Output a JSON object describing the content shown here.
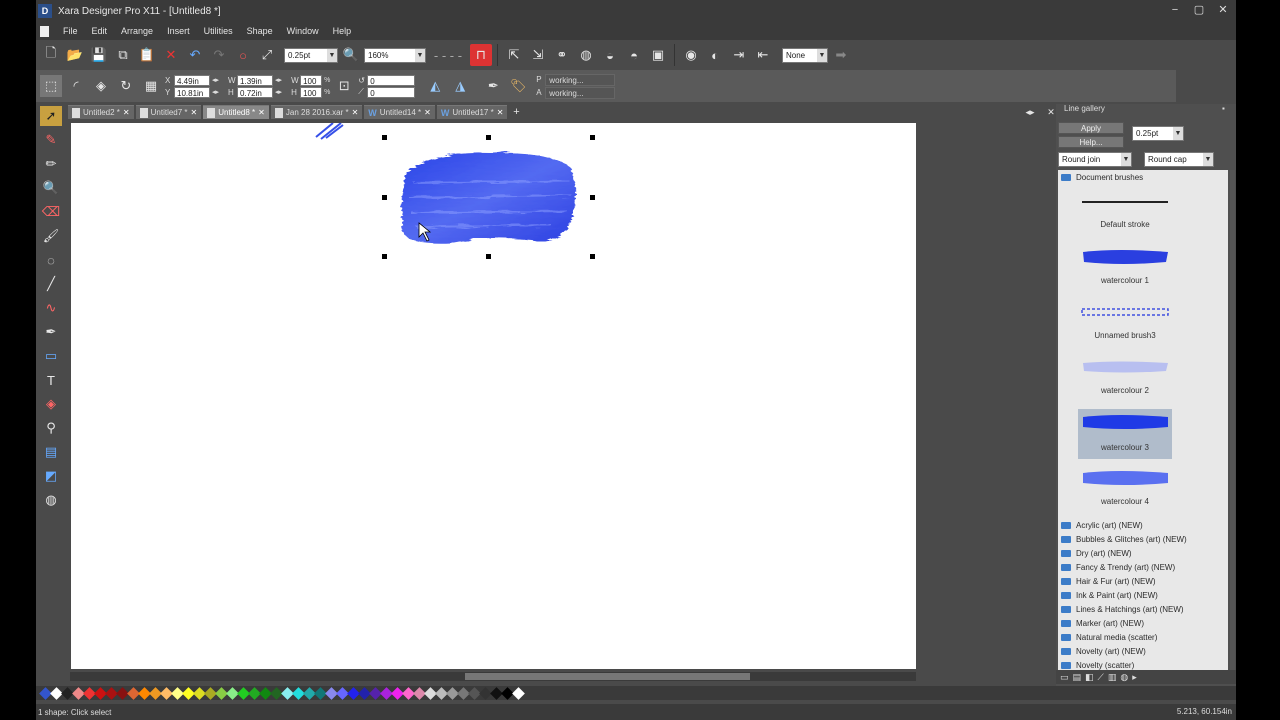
{
  "window": {
    "title": "Xara Designer Pro X11 - [Untitled8 *]",
    "logo": "D"
  },
  "menu": [
    "File",
    "Edit",
    "Arrange",
    "Insert",
    "Utilities",
    "Shape",
    "Window",
    "Help"
  ],
  "toolbar": {
    "line_width": "0.25pt",
    "zoom": "160%",
    "fill": "None"
  },
  "infobar": {
    "x": "4.49in",
    "y": "10.81in",
    "w": "1.39in",
    "h": "0.72in",
    "w_pct": "100",
    "h_pct": "100",
    "angle": "0",
    "skew": "0",
    "p_label": "P",
    "p_value": "working...",
    "a_label": "A",
    "a_value": "working..."
  },
  "tabs": [
    {
      "label": "Untitled2 *",
      "type": "doc"
    },
    {
      "label": "Untitled7 *",
      "type": "doc"
    },
    {
      "label": "Untitled8 *",
      "type": "doc",
      "active": true
    },
    {
      "label": "Jan 28 2016.xar *",
      "type": "doc"
    },
    {
      "label": "Untitled14 *",
      "type": "web"
    },
    {
      "label": "Untitled17 *",
      "type": "web"
    }
  ],
  "gallery": {
    "title": "Line gallery",
    "apply": "Apply",
    "help": "Help...",
    "width_value": "0.25pt",
    "join": "Round join",
    "cap": "Round cap",
    "doc_folder": "Document brushes",
    "brushes": [
      "Default stroke",
      "watercolour 1",
      "Unnamed brush3",
      "watercolour 2",
      "watercolour 3",
      "watercolour 4"
    ],
    "folders": [
      "Acrylic (art) (NEW)",
      "Bubbles & Glitches (art) (NEW)",
      "Dry (art) (NEW)",
      "Fancy & Trendy (art) (NEW)",
      "Hair & Fur (art) (NEW)",
      "Ink & Paint (art) (NEW)",
      "Lines & Hatchings (art) (NEW)",
      "Marker (art) (NEW)",
      "Natural media (scatter)",
      "Novelty (art) (NEW)",
      "Novelty (scatter)"
    ]
  },
  "status": {
    "left": "1 shape: Click select",
    "right": "5.213, 60.154in"
  },
  "colors": {
    "accent_tool": "#c8a040",
    "brush_blue": "#2a3fe0"
  },
  "palette": [
    "#3355cc",
    "#ffffff",
    "#222222",
    "#ee8888",
    "#ee3333",
    "#cc1111",
    "#aa1111",
    "#881111",
    "#dd6633",
    "#ff8800",
    "#ee9922",
    "#ffbb66",
    "#ffff88",
    "#ffff22",
    "#dddd22",
    "#aaaa22",
    "#88cc44",
    "#88ee88",
    "#22cc22",
    "#22aa22",
    "#118811",
    "#226622",
    "#88eeee",
    "#22dddd",
    "#22aaaa",
    "#117777",
    "#8888ee",
    "#6666ff",
    "#2222ee",
    "#2222aa",
    "#5522aa",
    "#aa22dd",
    "#ee22ee",
    "#ff66cc",
    "#dd88aa",
    "#dddddd",
    "#bbbbbb",
    "#999999",
    "#777777",
    "#555555",
    "#333333",
    "#111111",
    "#000000",
    "#ffffff"
  ]
}
